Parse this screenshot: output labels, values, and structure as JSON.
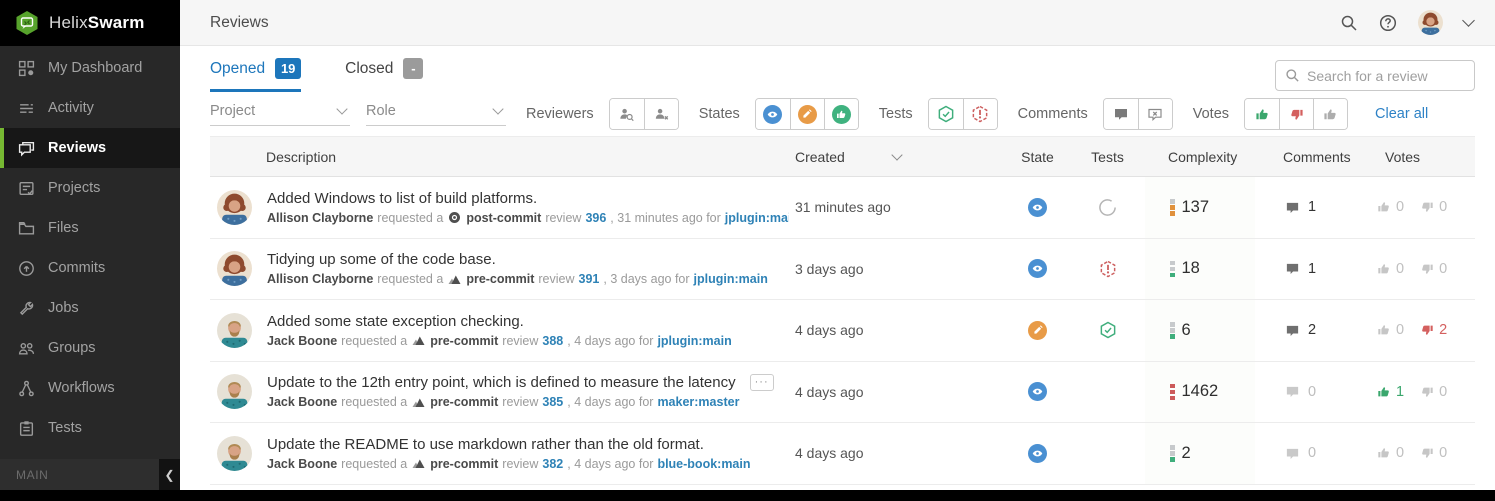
{
  "brand": {
    "helix": "Helix",
    "swarm": "Swarm"
  },
  "sidebar": {
    "items": [
      {
        "label": "My Dashboard"
      },
      {
        "label": "Activity"
      },
      {
        "label": "Reviews"
      },
      {
        "label": "Projects"
      },
      {
        "label": "Files"
      },
      {
        "label": "Commits"
      },
      {
        "label": "Jobs"
      },
      {
        "label": "Groups"
      },
      {
        "label": "Workflows"
      },
      {
        "label": "Tests"
      }
    ],
    "footer_label": "MAIN",
    "collapse_glyph": "❮"
  },
  "header": {
    "title": "Reviews"
  },
  "tabs": {
    "opened_label": "Opened",
    "opened_count": "19",
    "closed_label": "Closed",
    "closed_count": "-"
  },
  "search": {
    "placeholder": "Search for a review"
  },
  "filters": {
    "project_label": "Project",
    "role_label": "Role",
    "reviewers_label": "Reviewers",
    "states_label": "States",
    "tests_label": "Tests",
    "comments_label": "Comments",
    "votes_label": "Votes",
    "clear_all_label": "Clear all"
  },
  "table_headers": {
    "description": "Description",
    "created": "Created",
    "state": "State",
    "tests": "Tests",
    "complexity": "Complexity",
    "comments": "Comments",
    "votes": "Votes"
  },
  "colors": {
    "accent_green": "#76b832",
    "link_blue": "#2e82b6",
    "tab_blue": "#1d76bb",
    "state_review_blue": "#4a90d2",
    "state_revision_orange": "#e89b47",
    "state_approved_green": "#3fb27f",
    "tests_pass_green": "#3fae7c",
    "tests_fail_red": "#cd5f5f",
    "vote_up_green": "#3aa76d",
    "vote_down_red": "#d4605f"
  },
  "rows": [
    {
      "avatar": "allison",
      "title": "Added Windows to list of build platforms.",
      "author": "Allison Clayborne",
      "requested_text": "requested a",
      "commit_type": "post-commit",
      "review_word": "review",
      "review_id": "396",
      "tail_text": ", 31 minutes ago for",
      "branch": "jplugin:main",
      "created": "31 minutes ago",
      "state": "needs-review",
      "tests": "running",
      "complexity": {
        "value": "137",
        "seg1": "gray",
        "seg2": "orange",
        "seg3": "orange"
      },
      "comments": {
        "count": "1",
        "active": "true"
      },
      "votes": {
        "up": "0",
        "up_active": "false",
        "down": "0",
        "down_active": "false"
      }
    },
    {
      "avatar": "allison",
      "title": "Tidying up some of the code base.",
      "author": "Allison Clayborne",
      "requested_text": "requested a",
      "commit_type": "pre-commit",
      "review_word": "review",
      "review_id": "391",
      "tail_text": ", 3 days ago for",
      "branch": "jplugin:main",
      "created": "3 days ago",
      "state": "needs-review",
      "tests": "failed",
      "complexity": {
        "value": "18",
        "seg1": "gray",
        "seg2": "gray",
        "seg3": "green"
      },
      "comments": {
        "count": "1",
        "active": "true"
      },
      "votes": {
        "up": "0",
        "up_active": "false",
        "down": "0",
        "down_active": "false"
      }
    },
    {
      "avatar": "jack",
      "title": "Added some state exception checking.",
      "author": "Jack Boone",
      "requested_text": "requested a",
      "commit_type": "pre-commit",
      "review_word": "review",
      "review_id": "388",
      "tail_text": ", 4 days ago for",
      "branch": "jplugin:main",
      "created": "4 days ago",
      "state": "needs-revision",
      "tests": "passed",
      "complexity": {
        "value": "6",
        "seg1": "gray",
        "seg2": "gray",
        "seg3": "green"
      },
      "comments": {
        "count": "2",
        "active": "true"
      },
      "votes": {
        "up": "0",
        "up_active": "false",
        "down": "2",
        "down_active": "true"
      }
    },
    {
      "avatar": "jack",
      "title": "Update to the 12th entry point, which is defined to measure the latency",
      "more_glyph": "···",
      "author": "Jack Boone",
      "requested_text": "requested a",
      "commit_type": "pre-commit",
      "review_word": "review",
      "review_id": "385",
      "tail_text": ", 4 days ago for",
      "branch": "maker:master",
      "created": "4 days ago",
      "state": "needs-review",
      "tests": "none",
      "complexity": {
        "value": "1462",
        "seg1": "red",
        "seg2": "red",
        "seg3": "red"
      },
      "comments": {
        "count": "0",
        "active": "false"
      },
      "votes": {
        "up": "1",
        "up_active": "true",
        "down": "0",
        "down_active": "false"
      }
    },
    {
      "avatar": "jack",
      "title": "Update the README to use markdown rather than the old format.",
      "author": "Jack Boone",
      "requested_text": "requested a",
      "commit_type": "pre-commit",
      "review_word": "review",
      "review_id": "382",
      "tail_text": ", 4 days ago for",
      "branch": "blue-book:main",
      "created": "4 days ago",
      "state": "needs-review",
      "tests": "none",
      "complexity": {
        "value": "2",
        "seg1": "gray",
        "seg2": "gray",
        "seg3": "green"
      },
      "comments": {
        "count": "0",
        "active": "false"
      },
      "votes": {
        "up": "0",
        "up_active": "false",
        "down": "0",
        "down_active": "false"
      }
    }
  ]
}
